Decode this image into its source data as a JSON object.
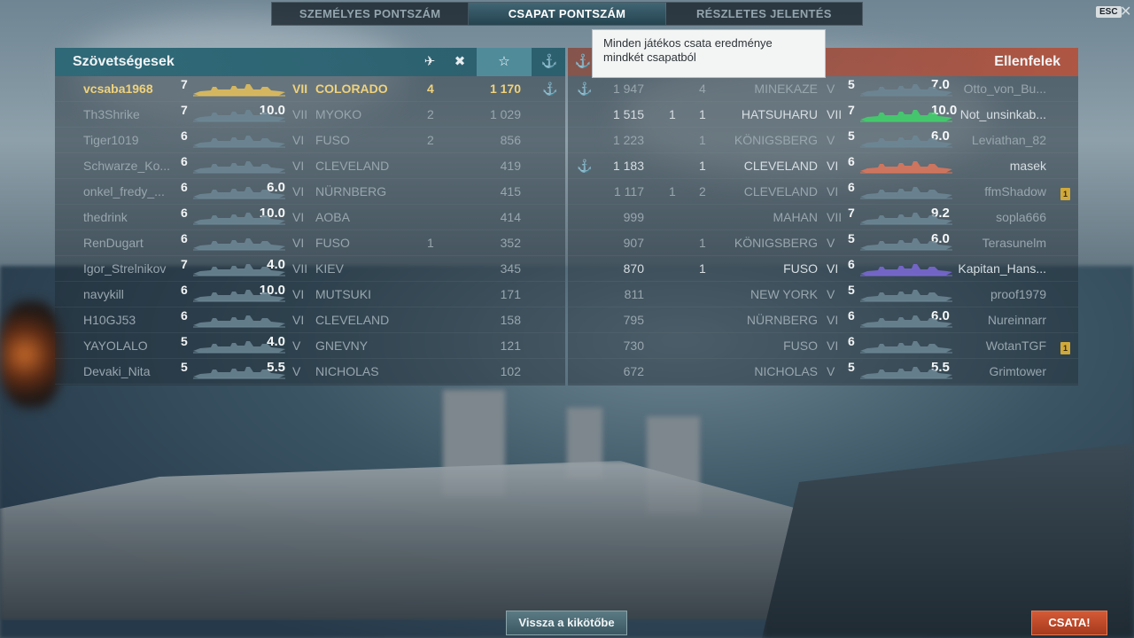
{
  "tabs": [
    {
      "label": "SZEMÉLYES PONTSZÁM",
      "active": false
    },
    {
      "label": "CSAPAT PONTSZÁM",
      "active": true
    },
    {
      "label": "RÉSZLETES JELENTÉS",
      "active": false
    }
  ],
  "esc_label": "ESC",
  "tooltip_text": "Minden játékos csata eredménye mindkét csapatból",
  "allies": {
    "title": "Szövetségesek",
    "rows": [
      {
        "name": "vcsaba1968",
        "tier_num": "7",
        "hp": "",
        "level": "VII",
        "ship": "COLORADO",
        "kills": "4",
        "xp": "1 170",
        "anchor": "⚓",
        "mine": true,
        "silhouette": "gold"
      },
      {
        "name": "Th3Shrike",
        "tier_num": "7",
        "hp": "10.0",
        "level": "VII",
        "ship": "MYOKO",
        "kills": "2",
        "xp": "1 029",
        "anchor": "",
        "silhouette": "blue"
      },
      {
        "name": "Tiger1019",
        "tier_num": "6",
        "hp": "",
        "level": "VI",
        "ship": "FUSO",
        "kills": "2",
        "xp": "856",
        "anchor": "",
        "silhouette": "blue"
      },
      {
        "name": "Schwarze_Ko...",
        "tier_num": "6",
        "hp": "",
        "level": "VI",
        "ship": "CLEVELAND",
        "kills": "",
        "xp": "419",
        "anchor": "",
        "silhouette": "blue"
      },
      {
        "name": "onkel_fredy_...",
        "tier_num": "6",
        "hp": "6.0",
        "level": "VI",
        "ship": "NÜRNBERG",
        "kills": "",
        "xp": "415",
        "anchor": "",
        "silhouette": "blue"
      },
      {
        "name": "thedrink",
        "tier_num": "6",
        "hp": "10.0",
        "level": "VI",
        "ship": "AOBA",
        "kills": "",
        "xp": "414",
        "anchor": "",
        "silhouette": "blue"
      },
      {
        "name": "RenDugart",
        "tier_num": "6",
        "hp": "",
        "level": "VI",
        "ship": "FUSO",
        "kills": "1",
        "xp": "352",
        "anchor": "",
        "silhouette": "blue"
      },
      {
        "name": "Igor_Strelnikov",
        "tier_num": "7",
        "hp": "4.0",
        "level": "VII",
        "ship": "KIEV",
        "kills": "",
        "xp": "345",
        "anchor": "",
        "silhouette": "blue"
      },
      {
        "name": "navykill",
        "tier_num": "6",
        "hp": "10.0",
        "level": "VI",
        "ship": "MUTSUKI",
        "kills": "",
        "xp": "171",
        "anchor": "",
        "silhouette": "blue"
      },
      {
        "name": "H10GJ53",
        "tier_num": "6",
        "hp": "",
        "level": "VI",
        "ship": "CLEVELAND",
        "kills": "",
        "xp": "158",
        "anchor": "",
        "silhouette": "blue"
      },
      {
        "name": "YAYOLALO",
        "tier_num": "5",
        "hp": "4.0",
        "level": "V",
        "ship": "GNEVNY",
        "kills": "",
        "xp": "121",
        "anchor": "",
        "silhouette": "blue"
      },
      {
        "name": "Devaki_Nita",
        "tier_num": "5",
        "hp": "5.5",
        "level": "V",
        "ship": "NICHOLAS",
        "kills": "",
        "xp": "102",
        "anchor": "",
        "silhouette": "blue"
      }
    ]
  },
  "enemies": {
    "title": "Ellenfelek",
    "rows": [
      {
        "name": "Otto_von_Bu...",
        "tier_num": "5",
        "hp": "7.0",
        "level": "V",
        "ship": "MINEKAZE",
        "planes": "",
        "kills": "4",
        "xp": "1 947",
        "anchor": "⚓",
        "badge": false,
        "silhouette": "blue"
      },
      {
        "name": "Not_unsinkab...",
        "tier_num": "7",
        "hp": "10.0",
        "level": "VII",
        "ship": "HATSUHARU",
        "planes": "1",
        "kills": "1",
        "xp": "1 515",
        "anchor": "",
        "badge": false,
        "silhouette": "green"
      },
      {
        "name": "Leviathan_82",
        "tier_num": "5",
        "hp": "6.0",
        "level": "V",
        "ship": "KÖNIGSBERG",
        "planes": "",
        "kills": "1",
        "xp": "1 223",
        "anchor": "",
        "badge": false,
        "silhouette": "blue"
      },
      {
        "name": "masek",
        "tier_num": "6",
        "hp": "",
        "level": "VI",
        "ship": "CLEVELAND",
        "planes": "",
        "kills": "1",
        "xp": "1 183",
        "anchor": "⚓",
        "badge": false,
        "silhouette": "orange"
      },
      {
        "name": "ffmShadow",
        "tier_num": "6",
        "hp": "",
        "level": "VI",
        "ship": "CLEVELAND",
        "planes": "1",
        "kills": "2",
        "xp": "1 117",
        "anchor": "",
        "badge": true,
        "silhouette": "blue"
      },
      {
        "name": "sopla666",
        "tier_num": "7",
        "hp": "9.2",
        "level": "VII",
        "ship": "MAHAN",
        "planes": "",
        "kills": "",
        "xp": "999",
        "anchor": "",
        "badge": false,
        "silhouette": "blue"
      },
      {
        "name": "Terasunelm",
        "tier_num": "5",
        "hp": "6.0",
        "level": "V",
        "ship": "KÖNIGSBERG",
        "planes": "",
        "kills": "1",
        "xp": "907",
        "anchor": "",
        "badge": false,
        "silhouette": "blue"
      },
      {
        "name": "Kapitan_Hans...",
        "tier_num": "6",
        "hp": "",
        "level": "VI",
        "ship": "FUSO",
        "planes": "",
        "kills": "1",
        "xp": "870",
        "anchor": "",
        "badge": false,
        "silhouette": "purple"
      },
      {
        "name": "proof1979",
        "tier_num": "5",
        "hp": "",
        "level": "V",
        "ship": "NEW YORK",
        "planes": "",
        "kills": "",
        "xp": "811",
        "anchor": "",
        "badge": false,
        "silhouette": "blue"
      },
      {
        "name": "Nureinnarr",
        "tier_num": "6",
        "hp": "6.0",
        "level": "VI",
        "ship": "NÜRNBERG",
        "planes": "",
        "kills": "",
        "xp": "795",
        "anchor": "",
        "badge": false,
        "silhouette": "blue"
      },
      {
        "name": "WotanTGF",
        "tier_num": "6",
        "hp": "",
        "level": "VI",
        "ship": "FUSO",
        "planes": "",
        "kills": "",
        "xp": "730",
        "anchor": "",
        "badge": true,
        "silhouette": "blue"
      },
      {
        "name": "Grimtower",
        "tier_num": "5",
        "hp": "5.5",
        "level": "V",
        "ship": "NICHOLAS",
        "planes": "",
        "kills": "",
        "xp": "672",
        "anchor": "",
        "badge": false,
        "silhouette": "blue"
      }
    ]
  },
  "header_icons": {
    "planes": "✈",
    "kills": "✖",
    "star": "☆",
    "anchor": "⚓"
  },
  "colors": {
    "ally_accent": "#2d6978",
    "enemy_accent": "#b45541",
    "mine_text": "#f0d27a",
    "silhouette_gold": "#e8c25a",
    "silhouette_blue": "#6d8795",
    "silhouette_green": "#3fd46a",
    "silhouette_orange": "#e0775a",
    "silhouette_purple": "#7d6ad8"
  },
  "buttons": {
    "back": "Vissza a kikötőbe",
    "battle": "CSATA!"
  }
}
